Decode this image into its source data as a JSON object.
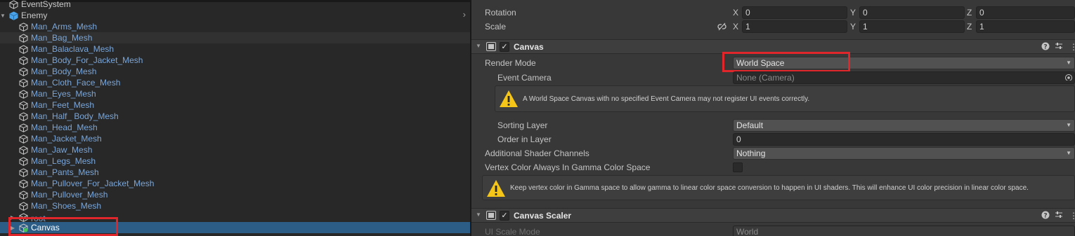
{
  "hierarchy": {
    "items": [
      {
        "label": "EventSystem",
        "kind": "top"
      },
      {
        "label": "Enemy",
        "kind": "top",
        "expanded": true
      },
      {
        "label": "Man_Arms_Mesh"
      },
      {
        "label": "Man_Bag_Mesh"
      },
      {
        "label": "Man_Balaclava_Mesh"
      },
      {
        "label": "Man_Body_For_Jacket_Mesh"
      },
      {
        "label": "Man_Body_Mesh"
      },
      {
        "label": "Man_Cloth_Face_Mesh"
      },
      {
        "label": "Man_Eyes_Mesh"
      },
      {
        "label": "Man_Feet_Mesh"
      },
      {
        "label": "Man_Half_ Body_Mesh"
      },
      {
        "label": "Man_Head_Mesh"
      },
      {
        "label": "Man_Jacket_Mesh"
      },
      {
        "label": "Man_Jaw_Mesh"
      },
      {
        "label": "Man_Legs_Mesh"
      },
      {
        "label": "Man_Pants_Mesh"
      },
      {
        "label": "Man_Pullover_For_Jacket_Mesh"
      },
      {
        "label": "Man_Pullover_Mesh"
      },
      {
        "label": "Man_Shoes_Mesh"
      },
      {
        "label": "root"
      },
      {
        "label": "Canvas",
        "selected": true
      }
    ]
  },
  "transform": {
    "rotation_label": "Rotation",
    "rotation": {
      "x": "0",
      "y": "0",
      "z": "0"
    },
    "scale_label": "Scale",
    "scale": {
      "x": "1",
      "y": "1",
      "z": "1"
    },
    "axis_x": "X",
    "axis_y": "Y",
    "axis_z": "Z"
  },
  "canvas": {
    "title": "Canvas",
    "enabled": true,
    "render_mode_label": "Render Mode",
    "render_mode_value": "World Space",
    "event_camera_label": "Event Camera",
    "event_camera_value": "None (Camera)",
    "warning_text": "A World Space Canvas with no specified Event Camera may not register UI events correctly.",
    "sorting_layer_label": "Sorting Layer",
    "sorting_layer_value": "Default",
    "order_in_layer_label": "Order in Layer",
    "order_in_layer_value": "0",
    "shader_channels_label": "Additional Shader Channels",
    "shader_channels_value": "Nothing",
    "vertex_color_label": "Vertex Color Always In Gamma Color Space",
    "vertex_color_checked": false,
    "info_text": "Keep vertex color in Gamma space to allow gamma to linear color space conversion to happen in UI shaders. This will enhance UI color precision in linear color space."
  },
  "canvas_scaler": {
    "title": "Canvas Scaler",
    "enabled": true,
    "ui_scale_mode_label": "UI Scale Mode",
    "ui_scale_mode_value": "World"
  },
  "colors": {
    "selection": "#2c5d87",
    "highlight_box": "#e0262b",
    "warning": "#f5c518",
    "link_blue": "#7aa6d9"
  },
  "icons": {
    "game_object": "cube-icon",
    "prefab": "blue-cube-icon",
    "canvas": "canvas-icon",
    "warning": "warning-icon",
    "help": "help-icon",
    "presets": "presets-icon",
    "menu": "kebab-menu-icon",
    "unlink": "unlinked-scale-icon"
  }
}
